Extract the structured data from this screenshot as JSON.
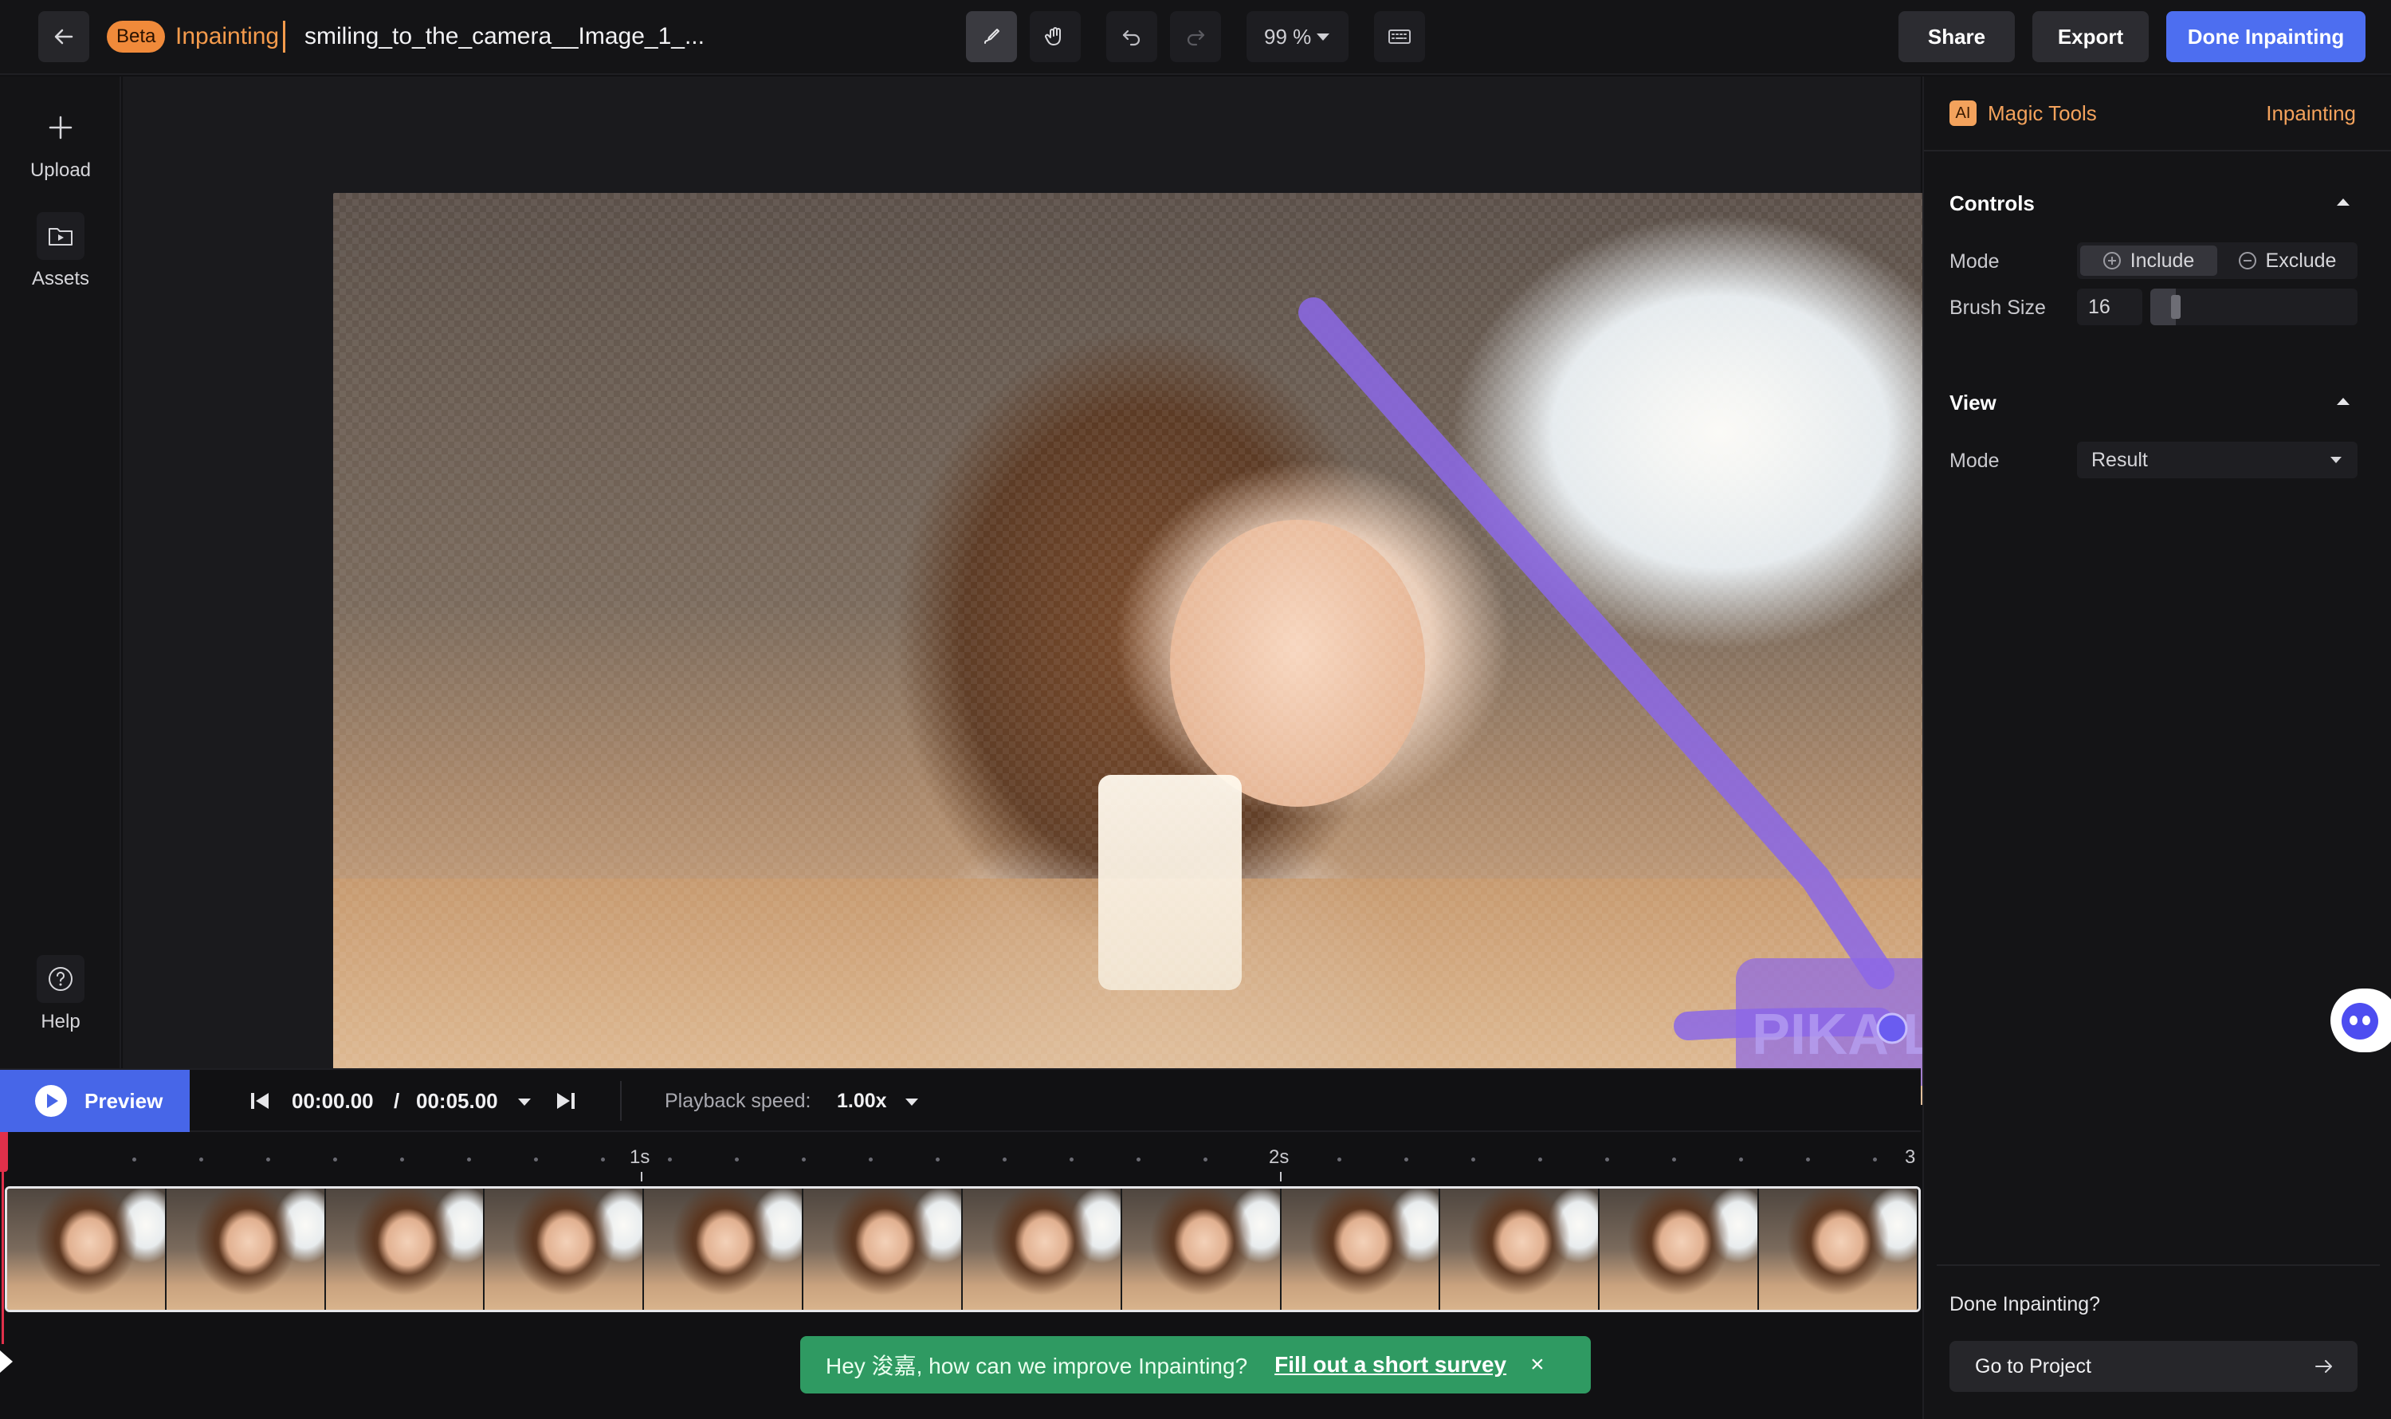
{
  "header": {
    "back_label": "",
    "beta_badge": "Beta",
    "mode_label": "Inpainting",
    "file_title": "smiling_to_the_camera__Image_1_...",
    "zoom": "99 %",
    "share_label": "Share",
    "export_label": "Export",
    "done_label": "Done Inpainting"
  },
  "sidebar": {
    "items": [
      {
        "label": "Upload",
        "icon": "plus-icon"
      },
      {
        "label": "Assets",
        "icon": "folder-play-icon"
      }
    ],
    "help_label": "Help"
  },
  "canvas": {
    "watermark_text": "PIKA LABS",
    "mask_color": "#8b67e8"
  },
  "right_panel": {
    "ai_badge": "AI",
    "magic_tools_label": "Magic Tools",
    "current_tool": "Inpainting",
    "controls": {
      "title": "Controls",
      "mode_label": "Mode",
      "include_label": "Include",
      "exclude_label": "Exclude",
      "selected_mode": "Include",
      "brush_size_label": "Brush Size",
      "brush_size_value": "16",
      "brush_size_fraction": 0.1
    },
    "view": {
      "title": "View",
      "mode_label": "Mode",
      "mode_value": "Result"
    },
    "done_question": "Done Inpainting?",
    "goto_label": "Go to Project"
  },
  "timeline": {
    "preview_label": "Preview",
    "current_time": "00:00.00",
    "separator": "/",
    "total_time": "00:05.00",
    "playback_speed_label": "Playback speed:",
    "playback_speed_value": "1.00x",
    "ruler_labels": [
      "1s",
      "2s",
      "3"
    ],
    "frame_count": 12
  },
  "survey": {
    "message": "Hey 浚嘉, how can we improve Inpainting?",
    "link_text": "Fill out a short survey",
    "close": "×"
  },
  "colors": {
    "accent_blue": "#4d6ef0",
    "accent_orange": "#f59b4c",
    "playhead_red": "#e0304a",
    "survey_green": "#2f9a62"
  }
}
